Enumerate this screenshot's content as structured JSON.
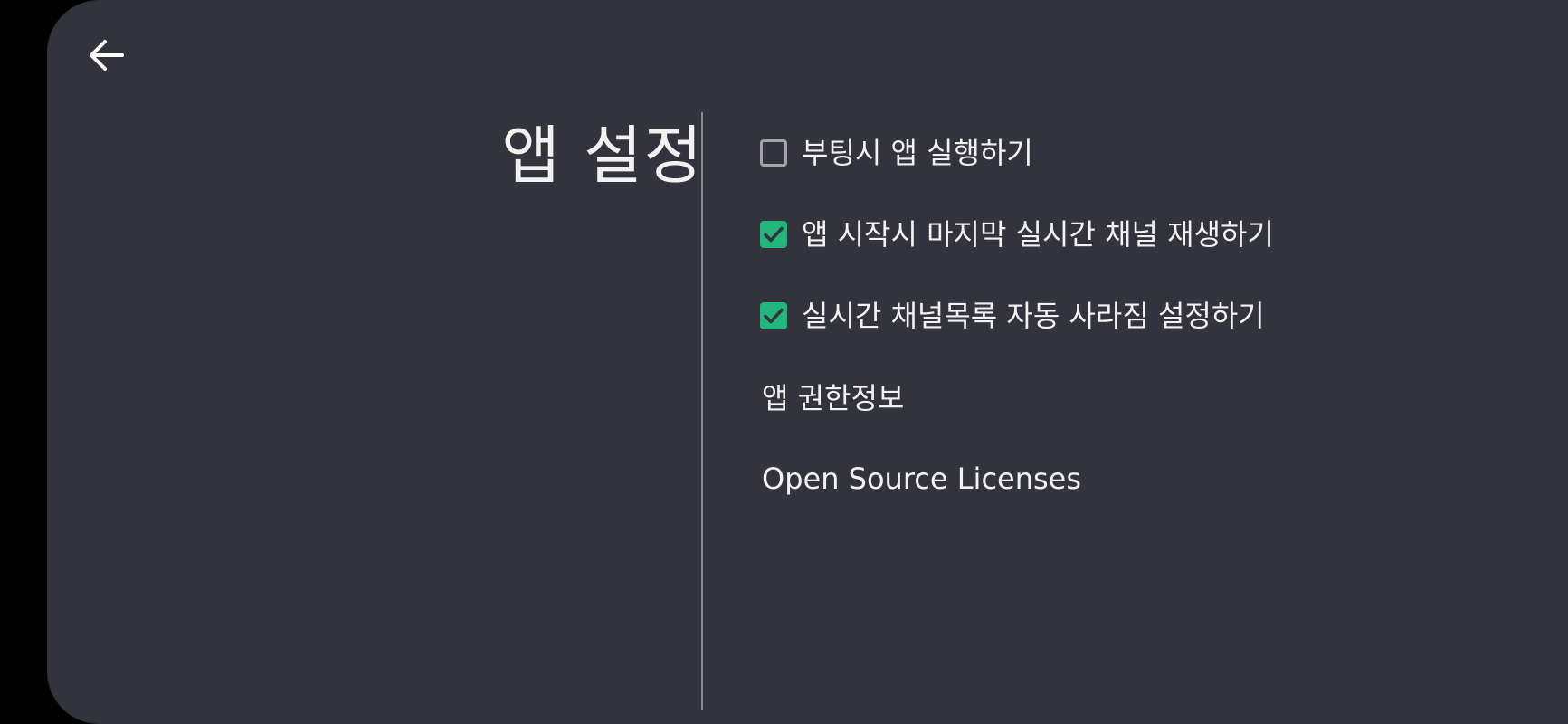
{
  "header": {
    "back_icon": "arrow-left-icon",
    "title": "앱 설정"
  },
  "settings": {
    "items": [
      {
        "label": "부팅시 앱 실행하기",
        "checked": false
      },
      {
        "label": "앱 시작시 마지막 실시간 채널 재생하기",
        "checked": true
      },
      {
        "label": "실시간 채널목록 자동 사라짐 설정하기",
        "checked": true
      }
    ],
    "links": [
      {
        "label": "앱 권한정보"
      },
      {
        "label": "Open Source Licenses"
      }
    ]
  },
  "colors": {
    "background": "#33333d",
    "accent_checked": "#22b67c",
    "text": "#f2f2f2",
    "divider": "#8a8a93"
  }
}
